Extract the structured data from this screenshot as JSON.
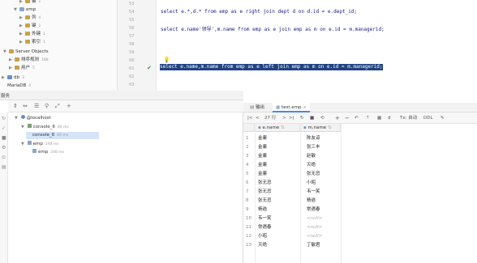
{
  "db_tree": {
    "items": [
      {
        "label": "键",
        "count": "1",
        "indent": 3,
        "icon": "key-folder-icon"
      },
      {
        "label": "emp",
        "count": "",
        "indent": 2,
        "icon": "table-icon"
      },
      {
        "label": "列",
        "count": "4",
        "indent": 3,
        "icon": "columns-folder-icon"
      },
      {
        "label": "键",
        "count": "1",
        "indent": 3,
        "icon": "key-folder-icon"
      },
      {
        "label": "外键",
        "count": "1",
        "indent": 3,
        "icon": "foreign-key-folder-icon"
      },
      {
        "label": "索引",
        "count": "1",
        "indent": 3,
        "icon": "index-folder-icon"
      },
      {
        "label": "Server Objects",
        "count": "",
        "indent": 1,
        "icon": "folder-icon"
      },
      {
        "label": "排序规则",
        "count": "188",
        "indent": 2,
        "icon": "collation-folder-icon"
      },
      {
        "label": "用户",
        "count": "5",
        "indent": 2,
        "icon": "users-folder-icon"
      },
      {
        "label": "db",
        "count": "3",
        "indent": 0,
        "icon": "database-icon"
      },
      {
        "label": "MariaDB",
        "count": "4",
        "indent": 0,
        "icon": "database-icon"
      }
    ]
  },
  "editor": {
    "line_numbers": [
      "53",
      "54",
      "55",
      "56",
      "57",
      "58",
      "59",
      "60",
      "61",
      "62",
      "63",
      "64"
    ],
    "lines": [
      {
        "no": "54",
        "text": "select e.*,d.* from emp as e right join dept d on d.id = e.dept_id;"
      },
      {
        "no": "56",
        "text": "select e.name'领导',m.name from emp as e join emp as m on e.id = m.managerid;"
      },
      {
        "no": "58",
        "text": "select e.name,m.name  from emp as e left join emp as m  on e.id = m.managerid;",
        "selected": true
      }
    ]
  },
  "sidebar_labels": {
    "services": "服务"
  },
  "services_tree": {
    "items": [
      {
        "label": "@localhost",
        "time": "",
        "indent": 0,
        "icon": "database-icon"
      },
      {
        "label": "console_6",
        "time": "80 ms",
        "indent": 1,
        "icon": "console-icon"
      },
      {
        "label": "console_6",
        "time": "80 ms",
        "indent": 2,
        "icon": "console-icon",
        "selected": true
      },
      {
        "label": "emp",
        "time": "248 ms",
        "indent": 1,
        "icon": "table-icon"
      },
      {
        "label": "emp",
        "time": "248 ms",
        "indent": 2,
        "icon": "table-icon"
      }
    ]
  },
  "results": {
    "tabs": [
      {
        "label": "输出",
        "icon": "output-icon"
      },
      {
        "label": "test.emp",
        "icon": "table-icon",
        "active": true
      }
    ],
    "toolbar": {
      "row_count": "27 行",
      "tx_label": "Tx: 自动",
      "ddl_label": "DDL"
    },
    "columns": [
      "e.name",
      "m.name"
    ],
    "rows": [
      {
        "n": "1",
        "a": "金庸",
        "b": "陈友谅"
      },
      {
        "n": "2",
        "a": "金庸",
        "b": "张三丰"
      },
      {
        "n": "3",
        "a": "金庸",
        "b": "赵敏"
      },
      {
        "n": "4",
        "a": "金庸",
        "b": "灭绝"
      },
      {
        "n": "5",
        "a": "金庸",
        "b": "张无忌"
      },
      {
        "n": "6",
        "a": "张无忌",
        "b": "小昭"
      },
      {
        "n": "7",
        "a": "张无忌",
        "b": "韦一笑"
      },
      {
        "n": "8",
        "a": "张无忌",
        "b": "杨逍"
      },
      {
        "n": "9",
        "a": "杨逍",
        "b": "常遇春"
      },
      {
        "n": "10",
        "a": "韦一笑",
        "b": "<null>"
      },
      {
        "n": "11",
        "a": "常遇春",
        "b": "<null>"
      },
      {
        "n": "12",
        "a": "小昭",
        "b": "<null>"
      },
      {
        "n": "13",
        "a": "灭绝",
        "b": "丁敏君"
      }
    ]
  },
  "colors": {
    "accent": "#4a86e8",
    "selection": "#214283",
    "keyword": "#000080",
    "string": "#067d17",
    "field": "#871094"
  }
}
